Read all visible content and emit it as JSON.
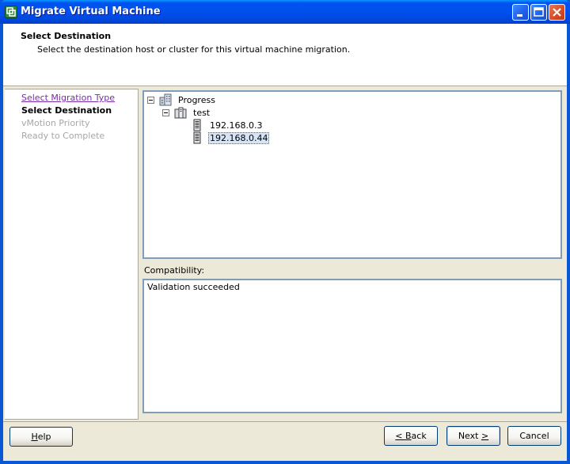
{
  "window": {
    "title": "Migrate Virtual Machine",
    "accent_color": "#0053EE"
  },
  "header": {
    "title": "Select Destination",
    "subtitle": "Select the destination host or cluster for this virtual machine migration."
  },
  "steps": [
    {
      "label": "Select Migration Type",
      "state": "visited-link"
    },
    {
      "label": "Select Destination",
      "state": "current"
    },
    {
      "label": "vMotion Priority",
      "state": "disabled"
    },
    {
      "label": "Ready to Complete",
      "state": "disabled"
    }
  ],
  "tree": {
    "root": {
      "label": "Progress",
      "icon": "datacenter-icon",
      "expanded": true
    },
    "cluster": {
      "label": "test",
      "icon": "cluster-icon",
      "expanded": true
    },
    "hosts": [
      {
        "label": "192.168.0.3",
        "icon": "host-server-icon",
        "selected": false
      },
      {
        "label": "192.168.0.44",
        "icon": "host-server-icon",
        "selected": true
      }
    ]
  },
  "compatibility": {
    "label": "Compatibility:",
    "message": "Validation succeeded"
  },
  "buttons": {
    "help": {
      "mnemonic": "H",
      "rest": "elp"
    },
    "back_prefix": "< ",
    "back": {
      "mnemonic": "B",
      "rest": "ack"
    },
    "next": {
      "pre": "Next ",
      "mnemonic": ">"
    },
    "cancel": "Cancel"
  }
}
